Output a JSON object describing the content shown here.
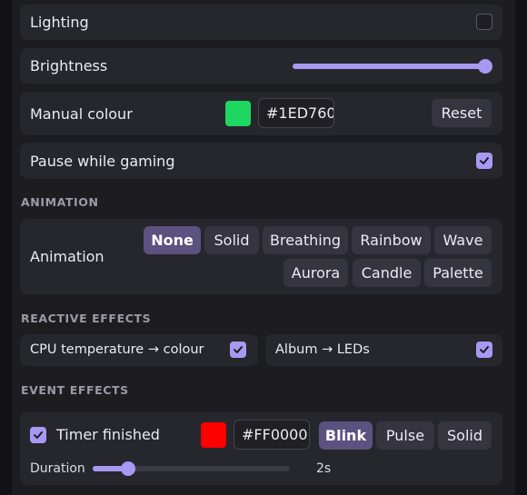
{
  "lighting": {
    "label": "Lighting",
    "enabled": false
  },
  "brightness": {
    "label": "Brightness",
    "value_fraction": 1.0
  },
  "manual_colour": {
    "label": "Manual colour",
    "color": "#1ED760",
    "hex": "#1ED760",
    "reset_label": "Reset"
  },
  "pause_gaming": {
    "label": "Pause while gaming",
    "checked": true
  },
  "animation": {
    "section_title": "ANIMATION",
    "label": "Animation",
    "options": [
      "None",
      "Solid",
      "Breathing",
      "Rainbow",
      "Wave",
      "Aurora",
      "Candle",
      "Palette"
    ],
    "selected": "None"
  },
  "reactive": {
    "section_title": "REACTIVE EFFECTS",
    "cpu_label": "CPU temperature → colour",
    "cpu_checked": true,
    "album_label": "Album → LEDs",
    "album_checked": true
  },
  "event": {
    "section_title": "EVENT EFFECTS",
    "timer_label": "Timer finished",
    "timer_checked": true,
    "color": "#FF0000",
    "hex": "#FF0000",
    "modes": [
      "Blink",
      "Pulse",
      "Solid"
    ],
    "selected_mode": "Blink",
    "duration_label": "Duration",
    "duration_value": "2s",
    "duration_fraction": 0.18
  },
  "colors": {
    "accent": "#a998f2",
    "selected_button": "#5b5280"
  }
}
